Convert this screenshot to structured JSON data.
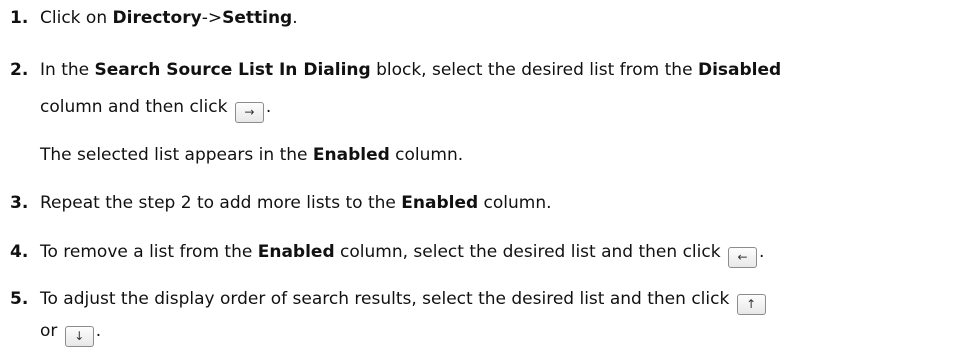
{
  "steps": [
    {
      "number": "1.",
      "parts": [
        "Click on ",
        "Directory",
        "->",
        "Setting",
        "."
      ]
    },
    {
      "number": "2.",
      "line1": [
        "In the ",
        "Search Source List In Dialing",
        " block, select the desired list from the ",
        "Disabled"
      ],
      "line2": [
        "column and then click",
        "."
      ],
      "button_icon": "→",
      "note": [
        "The selected list appears in the ",
        "Enabled",
        " column."
      ]
    },
    {
      "number": "3.",
      "parts": [
        "Repeat the step 2 to add more lists to the ",
        "Enabled",
        " column."
      ]
    },
    {
      "number": "4.",
      "parts": [
        "To remove a list from the ",
        "Enabled",
        " column, select the desired list and then click",
        "."
      ],
      "button_icon": "←"
    },
    {
      "number": "5.",
      "line1": "To adjust the display order of search results, select the desired list and then click",
      "up_icon": "↑",
      "line2": [
        "or",
        "."
      ],
      "down_icon": "↓"
    }
  ]
}
